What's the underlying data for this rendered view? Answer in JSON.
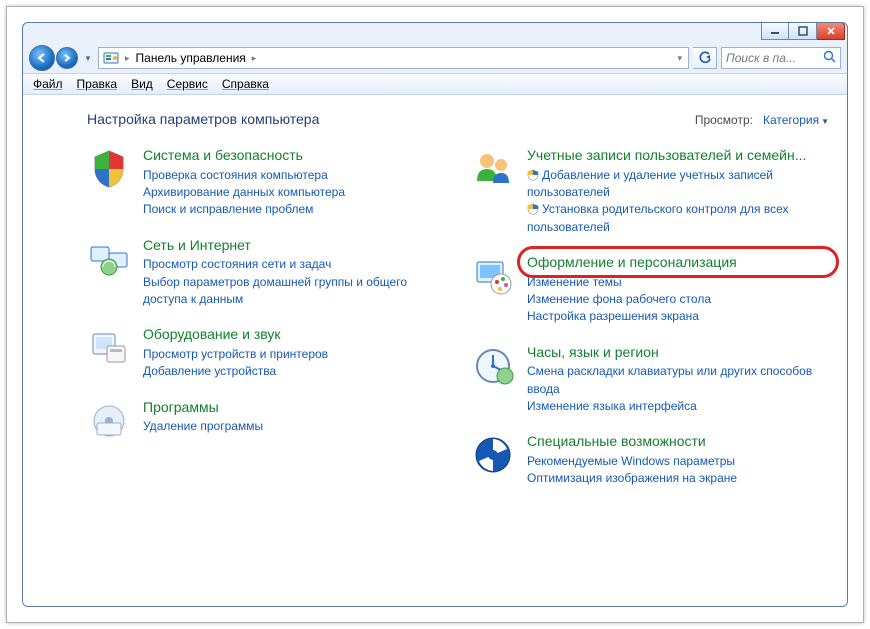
{
  "breadcrumb": {
    "root": "Панель управления"
  },
  "search": {
    "placeholder": "Поиск в па..."
  },
  "menus": {
    "file": "Файл",
    "edit": "Правка",
    "view": "Вид",
    "tools": "Сервис",
    "help": "Справка"
  },
  "heading": "Настройка параметров компьютера",
  "view_by": {
    "label": "Просмотр:",
    "value": "Категория"
  },
  "left": [
    {
      "title": "Система и безопасность",
      "links": [
        "Проверка состояния компьютера",
        "Архивирование данных компьютера",
        "Поиск и исправление проблем"
      ]
    },
    {
      "title": "Сеть и Интернет",
      "links": [
        "Просмотр состояния сети и задач",
        "Выбор параметров домашней группы и общего доступа к данным"
      ]
    },
    {
      "title": "Оборудование и звук",
      "links": [
        "Просмотр устройств и принтеров",
        "Добавление устройства"
      ]
    },
    {
      "title": "Программы",
      "links": [
        "Удаление программы"
      ]
    }
  ],
  "right": [
    {
      "title": "Учетные записи пользователей и семейн...",
      "links": [
        "Добавление и удаление учетных записей пользователей",
        "Установка родительского контроля для всех пользователей"
      ],
      "shielded": true
    },
    {
      "title": "Оформление и персонализация",
      "links": [
        "Изменение темы",
        "Изменение фона рабочего стола",
        "Настройка разрешения экрана"
      ],
      "highlighted": true
    },
    {
      "title": "Часы, язык и регион",
      "links": [
        "Смена раскладки клавиатуры или других способов ввода",
        "Изменение языка интерфейса"
      ]
    },
    {
      "title": "Специальные возможности",
      "links": [
        "Рекомендуемые Windows параметры",
        "Оптимизация изображения на экране"
      ]
    }
  ]
}
